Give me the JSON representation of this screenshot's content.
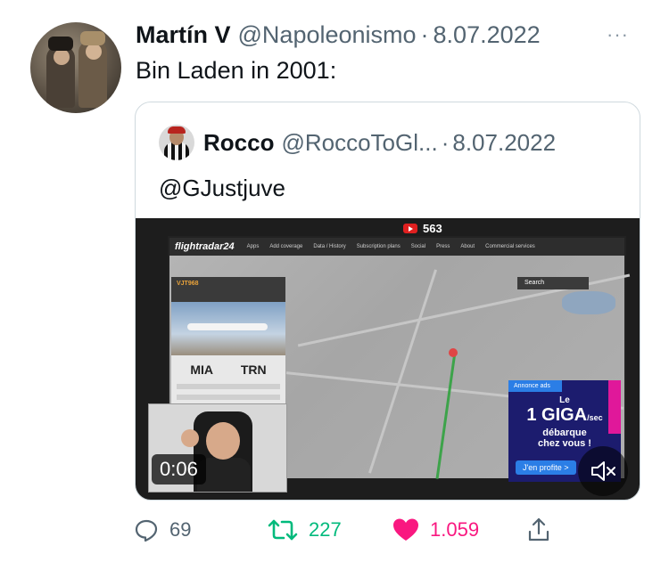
{
  "tweet": {
    "author_name": "Martín V",
    "author_handle": "@Napoleonismo",
    "separator": "·",
    "date": "8.07.2022",
    "more": "···",
    "text": "Bin Laden in 2001:"
  },
  "quoted": {
    "author_name": "Rocco",
    "author_handle": "@RoccoToGl...",
    "separator": "·",
    "date": "8.07.2022",
    "text": "@GJustjuve"
  },
  "video": {
    "duration": "0:06",
    "yt_count": "563",
    "fr_logo": "flightradar24",
    "fr_menu": [
      "Apps",
      "Add coverage",
      "Data / History",
      "Subscription plans",
      "Social",
      "Press",
      "About",
      "Commercial services"
    ],
    "fr_search": "Search",
    "fr_flight": "VJT968",
    "fr_from": "MIA",
    "fr_to": "TRN",
    "ad": {
      "top": "Annonce ads",
      "l1": "Le",
      "l2": "1 GIGA",
      "l2_suffix": "/sec",
      "l3": "débarque",
      "l4": "chez vous !",
      "button": "J'en profite >"
    }
  },
  "actions": {
    "reply_count": "69",
    "retweet_count": "227",
    "like_count": "1.059"
  },
  "colors": {
    "retweet": "#00ba7c",
    "like": "#f91880",
    "muted_text": "#536471"
  }
}
